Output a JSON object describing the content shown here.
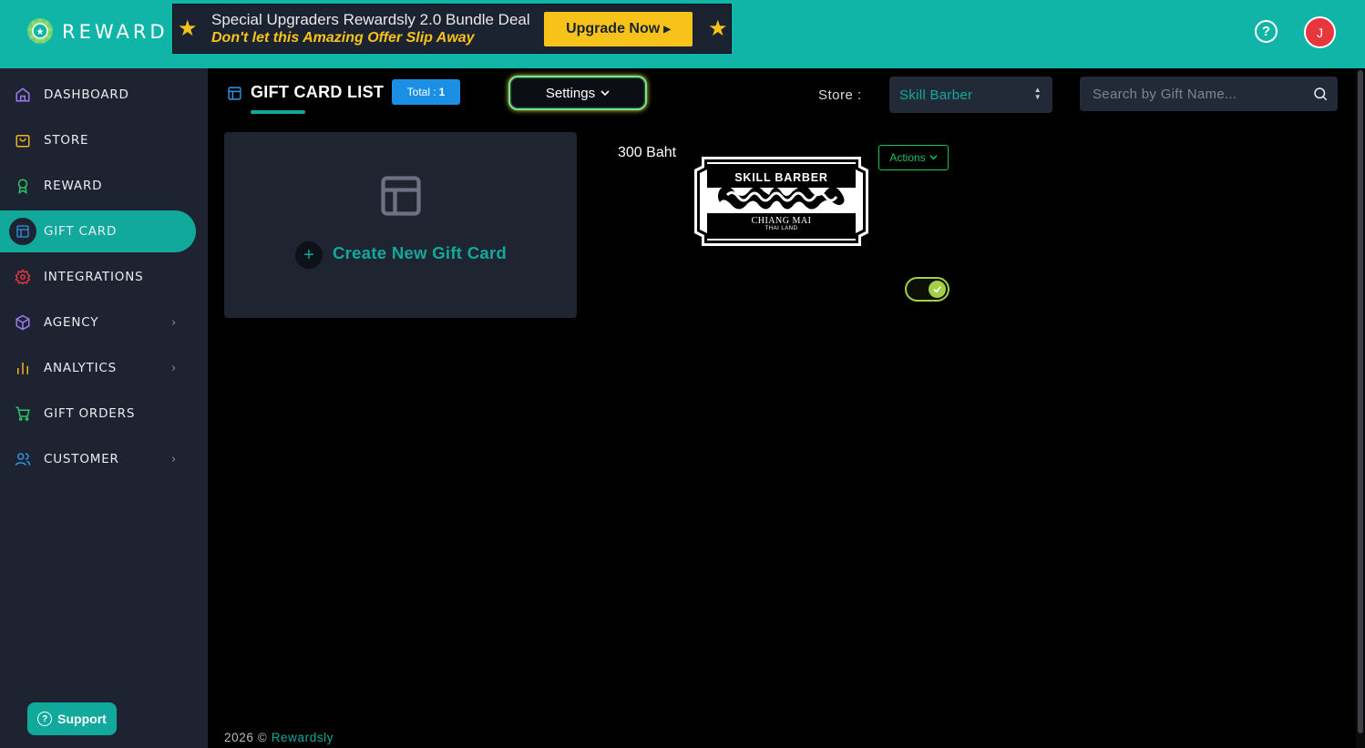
{
  "header": {
    "brand": "REWARD",
    "promo_line1": "Special Upgraders Rewardsly 2.0 Bundle Deal",
    "promo_line2": "Don't let this Amazing Offer Slip Away",
    "upgrade_label": "Upgrade Now",
    "help_icon": "question-circle-icon",
    "avatar_initial": "J",
    "accent_color": "#11b5a8",
    "promo_color": "#f7c31a",
    "avatar_color": "#e8363e"
  },
  "sidebar": {
    "items": [
      {
        "label": "DASHBOARD",
        "icon": "home-icon",
        "has_chevron": false
      },
      {
        "label": "STORE",
        "icon": "bag-icon",
        "has_chevron": false
      },
      {
        "label": "REWARD",
        "icon": "award-icon",
        "has_chevron": false
      },
      {
        "label": "GIFT CARD",
        "icon": "layout-icon",
        "has_chevron": false,
        "active": true
      },
      {
        "label": "INTEGRATIONS",
        "icon": "gear-icon",
        "has_chevron": false
      },
      {
        "label": "AGENCY",
        "icon": "cube-icon",
        "has_chevron": true
      },
      {
        "label": "ANALYTICS",
        "icon": "bar-chart-icon",
        "has_chevron": true
      },
      {
        "label": "GIFT ORDERS",
        "icon": "cart-icon",
        "has_chevron": false
      },
      {
        "label": "CUSTOMER",
        "icon": "users-icon",
        "has_chevron": true
      }
    ],
    "support_label": "Support"
  },
  "main": {
    "title": "GIFT CARD LIST",
    "total_label": "Total :",
    "total_count": "1",
    "settings_label": "Settings",
    "store_label": "Store :",
    "store_value": "Skill Barber",
    "search_placeholder": "Search by Gift Name...",
    "create_label": "Create New Gift Card",
    "gift_cards": [
      {
        "name": "300 Baht",
        "logo_line1": "SKILL BARBER",
        "logo_line2": "CHIANG MAI",
        "logo_line3": "THAI LAND",
        "actions_label": "Actions",
        "enabled": true
      }
    ]
  },
  "footer": {
    "year": "2026 ©",
    "brand": "Rewardsly"
  }
}
